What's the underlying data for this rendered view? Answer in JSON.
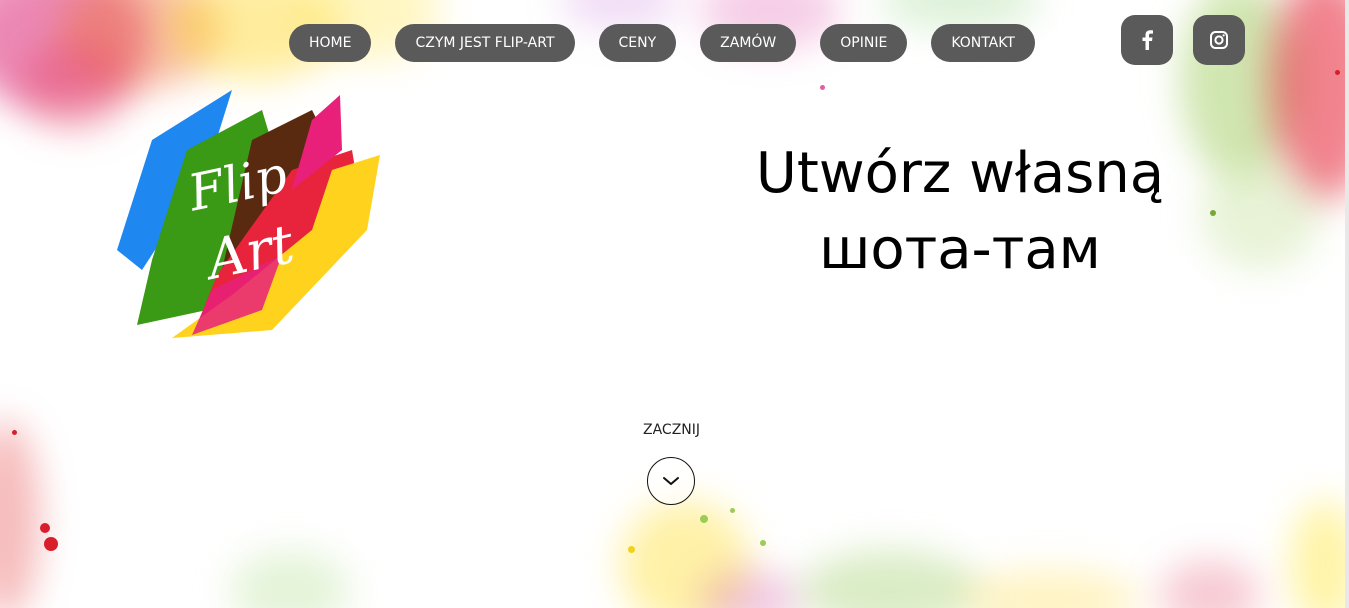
{
  "nav": {
    "items": [
      {
        "label": "HOME"
      },
      {
        "label": "CZYM JEST FLIP-ART"
      },
      {
        "label": "CENY"
      },
      {
        "label": "ZAMÓW"
      },
      {
        "label": "OPINIE"
      },
      {
        "label": "KONTAKT"
      }
    ]
  },
  "social": {
    "facebook_icon": "facebook-icon",
    "instagram_icon": "instagram-icon"
  },
  "logo": {
    "line1": "Flip",
    "line2": "Art"
  },
  "hero": {
    "line1": "Utwórz własną",
    "line2": "шота-там"
  },
  "start": {
    "label": "ZACZNIJ",
    "icon": "chevron-down-icon"
  },
  "colors": {
    "nav_bg": "#5a5a5a",
    "nav_text": "#ffffff",
    "logo_blue": "#1e88f0",
    "logo_green": "#3a9a16",
    "logo_brown": "#5a2a10",
    "logo_red": "#e8243c",
    "logo_pink": "#e8207a",
    "logo_yellow": "#ffd21e"
  }
}
